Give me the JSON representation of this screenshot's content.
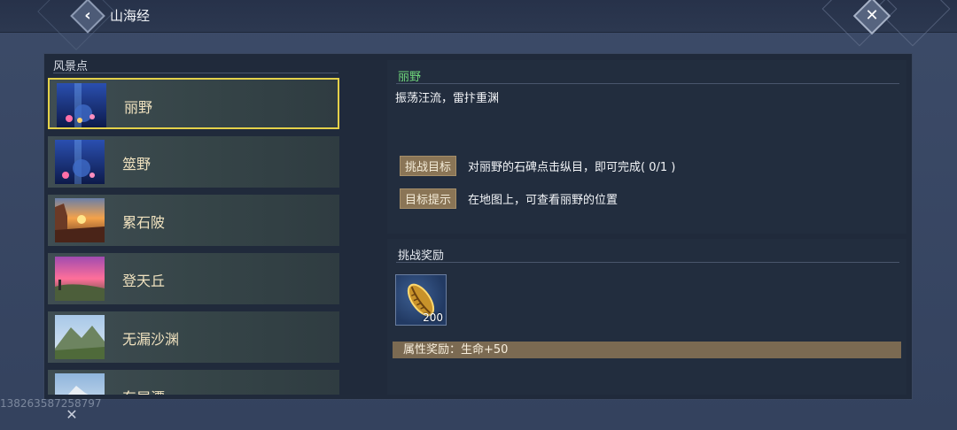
{
  "header": {
    "title": "山海经",
    "back_icon": "‹",
    "close_icon": "✕"
  },
  "left": {
    "title": "风景点",
    "items": [
      {
        "label": "丽野",
        "thumb": "night-sky-thumbnail"
      },
      {
        "label": "筮野",
        "thumb": "night-sky-thumbnail"
      },
      {
        "label": "累石陂",
        "thumb": "sunset-rocks-thumbnail"
      },
      {
        "label": "登天丘",
        "thumb": "pink-sky-hill-thumbnail"
      },
      {
        "label": "无漏沙渊",
        "thumb": "green-mountain-thumbnail"
      },
      {
        "label": "东屋潭",
        "thumb": "snow-mountain-thumbnail"
      }
    ],
    "selected_index": 0
  },
  "detail": {
    "name": "丽野",
    "description": "振荡汪流，雷抃重渊",
    "goal_tag": "挑战目标",
    "goal_text": "对丽野的石碑点击纵目，即可完成( 0/1 )",
    "hint_tag": "目标提示",
    "hint_text": "在地图上，可查看丽野的位置"
  },
  "reward": {
    "title": "挑战奖励",
    "item_icon": "golden-shell-icon",
    "item_count": "200",
    "attr_text": "属性奖励：生命+50"
  },
  "watermark": "138263587258797",
  "colors": {
    "selected_border": "#e4d14a",
    "name_green": "#6fd67a",
    "tag_bg": "#8a7556"
  }
}
